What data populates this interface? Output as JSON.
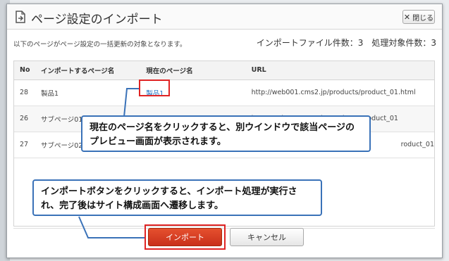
{
  "dialog": {
    "title": "ページ設定のインポート",
    "close_label": "閉じる",
    "description": "以下のページがページ設定の一括更新の対象となります。",
    "summary": "インポートファイル件数：3　処理対象件数：3"
  },
  "table": {
    "headers": [
      "No",
      "インポートするページ名",
      "現在のページ名",
      "URL"
    ],
    "rows": [
      {
        "no": "28",
        "import_name": "製品1",
        "current_name": "製品1",
        "url": "http://web001.cms2.jp/products/product_01.html"
      },
      {
        "no": "26",
        "import_name": "サブページ01",
        "current_name": "サブページ01",
        "url": "http://web001.cms2.jp/products/product_01"
      },
      {
        "no": "27",
        "import_name": "サブページ02",
        "current_name": "",
        "url": "roduct_01"
      }
    ]
  },
  "callouts": {
    "preview": "現在のページ名をクリックすると、別ウインドウで該当ページのプレビュー画面が表示されます。",
    "import": "インポートボタンをクリックすると、インポート処理が実行され、完了後はサイト構成画面へ遷移します。"
  },
  "buttons": {
    "import_label": "インポート",
    "cancel_label": "キャンセル"
  },
  "colors": {
    "import_button": "#d33d22",
    "highlight": "#e02424",
    "callout_border": "#3a72b8",
    "link": "#1a6bbf"
  },
  "icons": {
    "title": "import-page-icon",
    "close": "close-icon"
  }
}
